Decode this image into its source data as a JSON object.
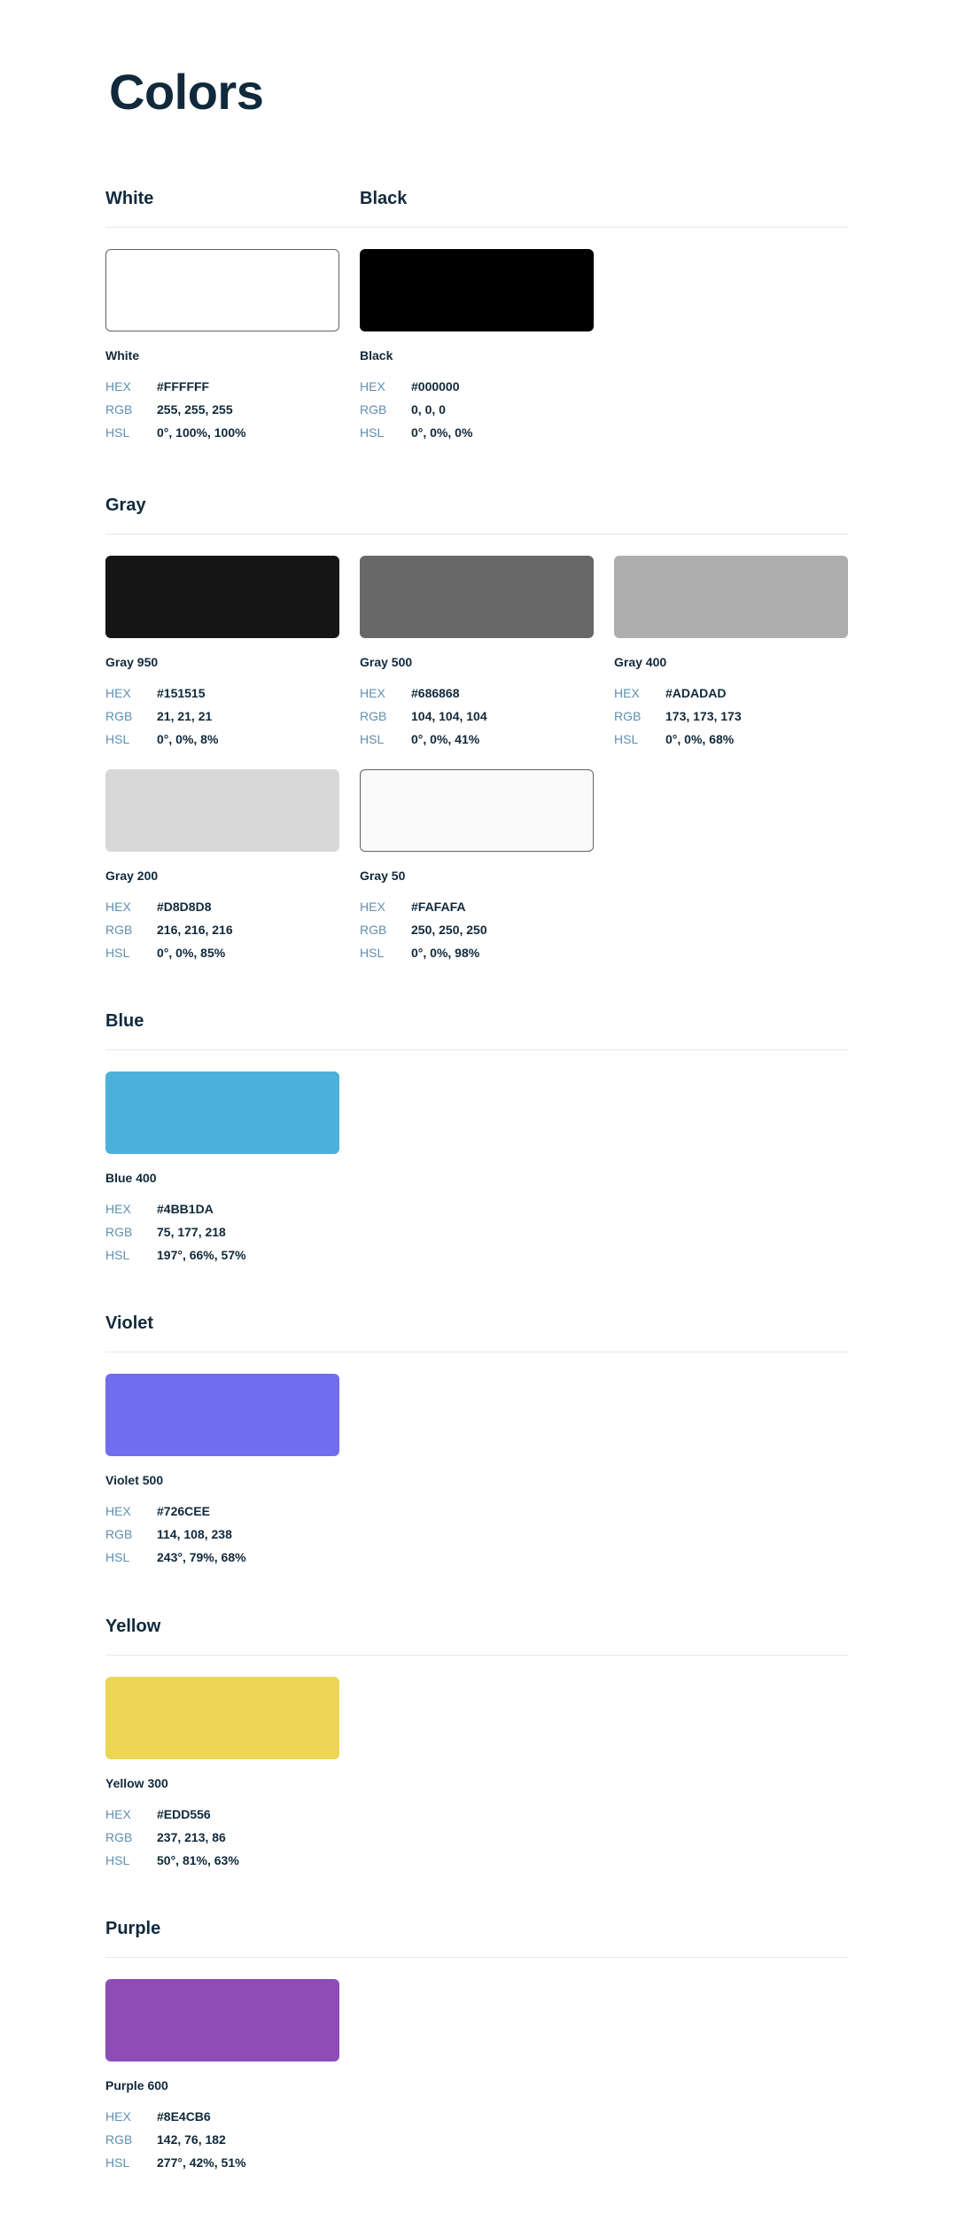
{
  "page": {
    "title": "Colors"
  },
  "labels": {
    "hex": "HEX",
    "rgb": "RGB",
    "hsl": "HSL"
  },
  "sections": {
    "white": {
      "title": "White",
      "colors": {
        "white": {
          "name": "White",
          "hex": "#FFFFFF",
          "rgb": "255, 255, 255",
          "hsl": "0°, 100%, 100%"
        }
      }
    },
    "black": {
      "title": "Black",
      "colors": {
        "black": {
          "name": "Black",
          "hex": "#000000",
          "rgb": "0, 0, 0",
          "hsl": "0°, 0%, 0%"
        }
      }
    },
    "gray": {
      "title": "Gray",
      "colors": {
        "gray950": {
          "name": "Gray 950",
          "hex": "#151515",
          "rgb": "21, 21, 21",
          "hsl": "0°, 0%, 8%"
        },
        "gray500": {
          "name": "Gray 500",
          "hex": "#686868",
          "rgb": "104, 104, 104",
          "hsl": "0°, 0%, 41%"
        },
        "gray400": {
          "name": "Gray 400",
          "hex": "#ADADAD",
          "rgb": "173, 173, 173",
          "hsl": "0°, 0%, 68%"
        },
        "gray200": {
          "name": "Gray 200",
          "hex": "#D8D8D8",
          "rgb": "216, 216, 216",
          "hsl": "0°, 0%, 85%"
        },
        "gray50": {
          "name": "Gray 50",
          "hex": "#FAFAFA",
          "rgb": "250, 250, 250",
          "hsl": "0°, 0%, 98%"
        }
      }
    },
    "blue": {
      "title": "Blue",
      "colors": {
        "blue400": {
          "name": "Blue 400",
          "hex": "#4BB1DA",
          "rgb": "75, 177, 218",
          "hsl": "197°, 66%, 57%"
        }
      }
    },
    "violet": {
      "title": "Violet",
      "colors": {
        "violet500": {
          "name": "Violet 500",
          "hex": "#726CEE",
          "rgb": "114, 108, 238",
          "hsl": "243°, 79%, 68%"
        }
      }
    },
    "yellow": {
      "title": "Yellow",
      "colors": {
        "yellow300": {
          "name": "Yellow 300",
          "hex": "#EDD556",
          "rgb": "237, 213, 86",
          "hsl": "50°, 81%, 63%"
        }
      }
    },
    "purple": {
      "title": "Purple",
      "colors": {
        "purple600": {
          "name": "Purple 600",
          "hex": "#8E4CB6",
          "rgb": "142, 76, 182",
          "hsl": "277°, 42%, 51%"
        }
      }
    }
  }
}
